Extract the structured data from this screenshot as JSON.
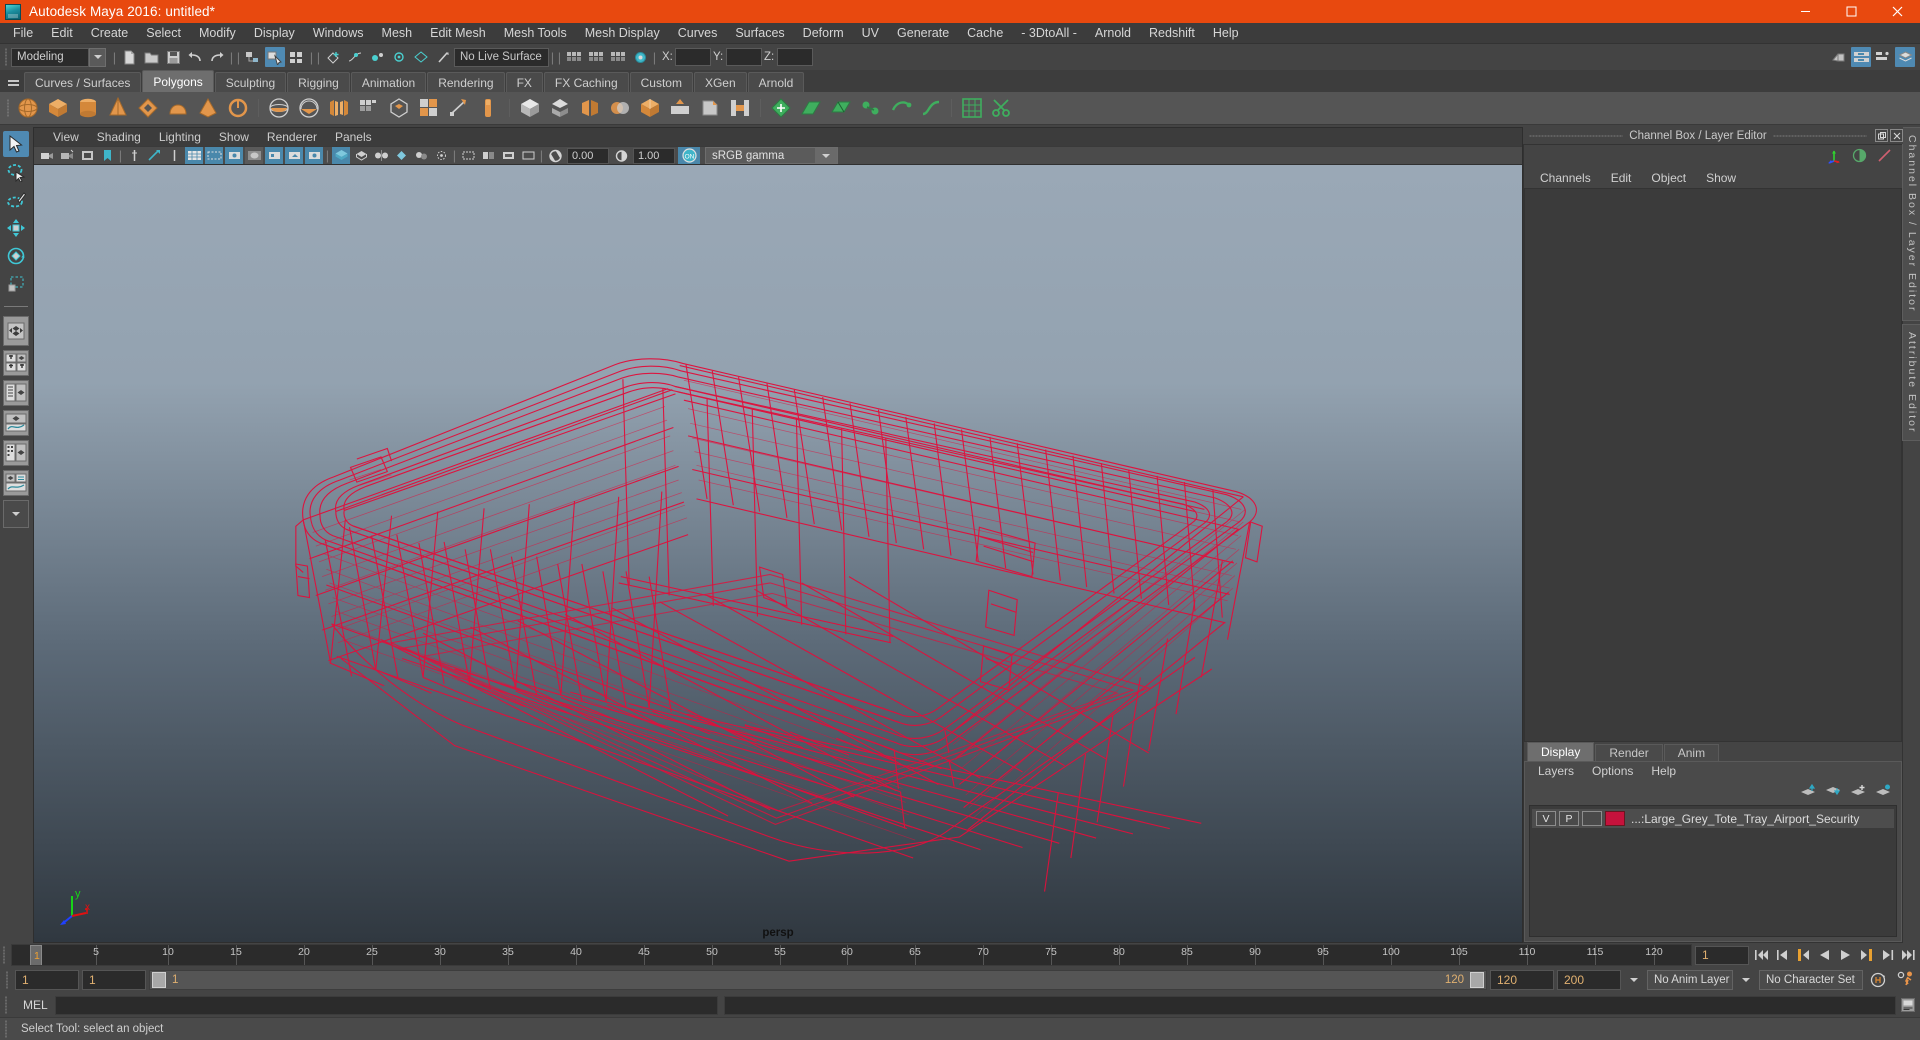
{
  "titlebar": {
    "title": "Autodesk Maya 2016: untitled*",
    "logo_icon": "maya-logo-icon",
    "minimize_icon": "minimize-icon",
    "maximize_icon": "maximize-icon",
    "close_icon": "close-icon"
  },
  "menubar": {
    "items": [
      "File",
      "Edit",
      "Create",
      "Select",
      "Modify",
      "Display",
      "Windows",
      "Mesh",
      "Edit Mesh",
      "Mesh Tools",
      "Mesh Display",
      "Curves",
      "Surfaces",
      "Deform",
      "UV",
      "Generate",
      "Cache",
      "- 3DtoAll -",
      "Arnold",
      "Redshift",
      "Help"
    ]
  },
  "statusline": {
    "mode_select": "Modeling",
    "mode_dropdown_icon": "chevron-down-icon",
    "live_surface": "No Live Surface",
    "coord_labels": [
      "X:",
      "Y:",
      "Z:"
    ],
    "coord_values": [
      "",
      "",
      ""
    ],
    "icons": [
      "new-scene-icon",
      "open-scene-icon",
      "save-scene-icon",
      "undo-icon",
      "redo-icon",
      "select-hierarchy-icon",
      "select-object-icon",
      "select-component-icon",
      "snap-grid-icon",
      "snap-curve-icon",
      "snap-point-icon",
      "snap-projected-icon",
      "snap-view-plane-icon",
      "make-live-icon",
      "show-hide-editors-icon",
      "attribute-editor-icon",
      "tool-settings-icon",
      "channel-box-icon"
    ]
  },
  "shelf": {
    "hamburger_icon": "shelf-menu-icon",
    "tabs": [
      "Curves / Surfaces",
      "Polygons",
      "Sculpting",
      "Rigging",
      "Animation",
      "Rendering",
      "FX",
      "FX Caching",
      "Custom",
      "XGen",
      "Arnold"
    ],
    "active_tab": "Polygons",
    "buttons": [
      "poly-sphere-icon",
      "poly-cube-icon",
      "poly-cylinder-icon",
      "poly-cone-icon",
      "poly-torus-icon",
      "poly-plane-icon",
      "poly-disc-icon",
      "poly-platonic-icon",
      "poly-sphere-alt-icon",
      "poly-helix-icon",
      "poly-pipe-icon",
      "poly-prism-icon",
      "poly-pyramid-icon",
      "poly-soccer-icon",
      "poly-gear-icon",
      "poly-super-ellipse-icon",
      "combine-icon",
      "separate-icon",
      "mirror-icon",
      "boolean-icon",
      "smooth-icon",
      "extrude-icon",
      "bevel-icon",
      "bridge-icon",
      "append-icon",
      "wedge-icon",
      "multi-cut-icon",
      "target-weld-icon",
      "quad-draw-icon",
      "crease-icon",
      "uv-editor-icon",
      "cut-uv-icon"
    ]
  },
  "toolbox": {
    "tools": [
      "select-tool-icon",
      "lasso-select-tool-icon",
      "paint-select-tool-icon",
      "move-tool-icon",
      "rotate-tool-icon",
      "scale-tool-icon"
    ],
    "active_tool": "select-tool-icon",
    "layout_presets": [
      "single-perspective-layout-icon",
      "four-view-layout-icon",
      "outliner-persp-layout-icon",
      "persp-graph-layout-icon",
      "hypershade-persp-layout-icon",
      "persp-graph-outliner-layout-icon",
      "more-layouts-icon"
    ]
  },
  "viewport": {
    "menus": [
      "View",
      "Shading",
      "Lighting",
      "Show",
      "Renderer",
      "Panels"
    ],
    "camera_label": "persp",
    "exposure_value": "0.00",
    "gamma_value": "1.00",
    "color_management_toggle": "ON",
    "view_transform": "sRGB gamma",
    "view_transform_arrow_icon": "chevron-down-icon",
    "axis_gizmo": {
      "x": "x",
      "y": "y",
      "z": "z"
    },
    "toolbar_icons": [
      "select-camera-icon",
      "lock-camera-icon",
      "camera-attributes-icon",
      "bookmark-icon",
      "image-plane-icon",
      "two-d-pan-zoom-icon",
      "grid-toggle-icon",
      "film-gate-icon",
      "resolution-gate-icon",
      "gate-mask-icon",
      "xray-icon",
      "xray-joints-icon",
      "smooth-shade-icon",
      "wireframe-on-shaded-icon",
      "textured-icon",
      "lights-icon",
      "shadows-icon",
      "screen-space-ao-icon",
      "motion-blur-icon",
      "multisample-icon",
      "depth-of-field-icon",
      "isolate-select-icon",
      "exposure-icon",
      "gamma-icon",
      "color-management-icon"
    ],
    "model_description": "Large Grey Tote Tray Airport Security wireframe mesh"
  },
  "right_dock": {
    "panel_title": "Channel Box / Layer Editor",
    "undock_icon": "undock-icon",
    "close_icon": "close-icon",
    "channel_box": {
      "menus": [
        "Channels",
        "Edit",
        "Object",
        "Show"
      ],
      "tool_icons": [
        "manipulator-icon",
        "half-circle-icon",
        "slash-icon"
      ],
      "rows": []
    },
    "layer_editor": {
      "tabs": [
        "Display",
        "Render",
        "Anim"
      ],
      "active_tab": "Display",
      "menus": [
        "Layers",
        "Options",
        "Help"
      ],
      "action_icons": [
        "move-layer-up-icon",
        "move-layer-down-icon",
        "new-layer-icon",
        "new-layer-from-selected-icon"
      ],
      "layers": [
        {
          "visibility": "V",
          "playback": "P",
          "shading": "",
          "color": "#c6123c",
          "name": "...:Large_Grey_Tote_Tray_Airport_Security"
        }
      ]
    },
    "vertical_tabs": [
      "Channel Box / Layer Editor",
      "Attribute Editor"
    ]
  },
  "timeslider": {
    "start": 1,
    "end": 120,
    "current_frame": "1",
    "tick_step": 5,
    "tick_labels": [
      5,
      10,
      15,
      20,
      25,
      30,
      35,
      40,
      45,
      50,
      55,
      60,
      65,
      70,
      75,
      80,
      85,
      90,
      95,
      100,
      105,
      110,
      115,
      120
    ],
    "cursor_label": "1",
    "max_label": "120",
    "playback_buttons": [
      "go-to-start-icon",
      "step-back-keyframe-icon",
      "step-back-frame-icon",
      "play-backwards-icon",
      "play-forwards-icon",
      "step-forward-frame-icon",
      "step-forward-keyframe-icon",
      "go-to-end-icon"
    ]
  },
  "rangeslider": {
    "anim_start": "1",
    "range_start": "1",
    "bar_min_label": "1",
    "bar_max_label": "120",
    "range_end": "120",
    "anim_end": "200",
    "anim_layer": "No Anim Layer",
    "character_set": "No Character Set",
    "anim_layer_arrow_icon": "chevron-down-icon",
    "character_set_arrow_icon": "chevron-down-icon",
    "auto_key_icon": "auto-keyframe-icon",
    "anim_prefs_icon": "animation-preferences-icon"
  },
  "commandline": {
    "language_label": "MEL",
    "input_value": "",
    "output_value": "",
    "script_editor_icon": "script-editor-icon"
  },
  "helpline": {
    "message": "Select Tool: select an object"
  },
  "colors": {
    "title_bar": "#e8490f",
    "chrome": "#444444",
    "panel_dark": "#2b2b2b",
    "accent_blue": "#4f8ab3",
    "shelf_orange": "#e2964b",
    "wireframe_red": "#e01040",
    "layer_color": "#c6123c"
  }
}
